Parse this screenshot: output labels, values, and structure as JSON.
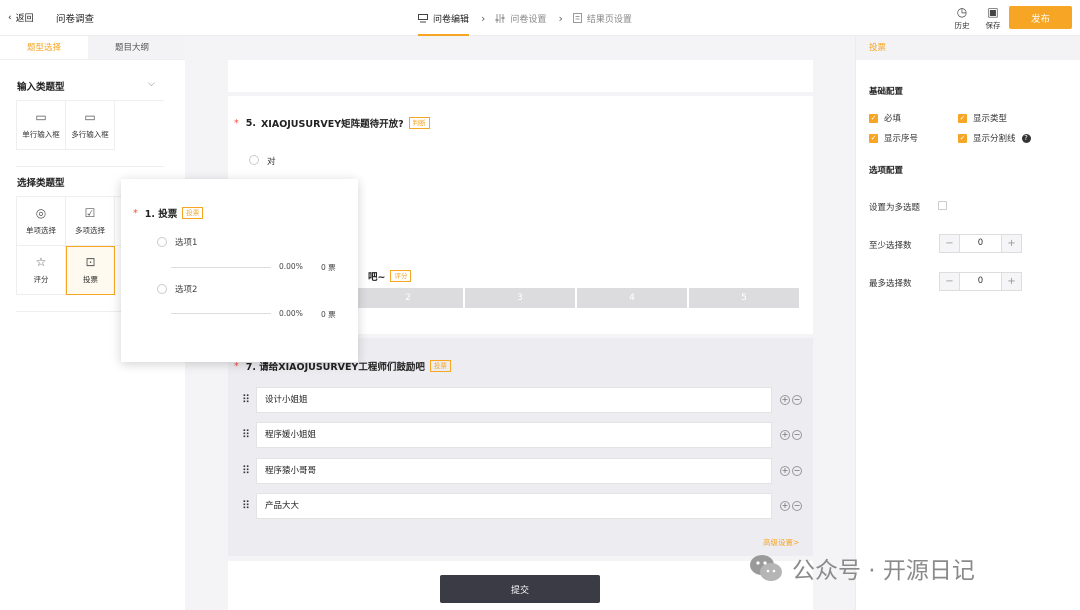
{
  "header": {
    "back_label": "返回",
    "title": "问卷调查",
    "steps": [
      {
        "label": "问卷编辑",
        "icon": "form-icon"
      },
      {
        "label": "问卷设置",
        "icon": "tune-icon"
      },
      {
        "label": "结果页设置",
        "icon": "doc-icon"
      }
    ],
    "history_label": "历史",
    "save_label": "保存",
    "publish_label": "发布",
    "accent": "#f7a524"
  },
  "left": {
    "tabs": [
      "题型选择",
      "题目大纲"
    ],
    "input_section": "输入类题型",
    "input_types": [
      "单行输入框",
      "多行输入框"
    ],
    "select_section": "选择类题型",
    "select_types": [
      "单项选择",
      "多项选择",
      "评分",
      "投票"
    ]
  },
  "canvas": {
    "q5": {
      "number": "5.",
      "title": "XIAOJUSURVEY矩阵题待开放?",
      "tag": "判断",
      "option": "对"
    },
    "q6": {
      "title_tail": "吧~",
      "tag": "评分",
      "scores": [
        "2",
        "3",
        "4",
        "5"
      ]
    },
    "q7": {
      "title": "7. 请给XIAOJUSURVEY工程师们鼓励吧",
      "tag": "投票",
      "options": [
        "设计小姐姐",
        "程序媛小姐姐",
        "程序猿小哥哥",
        "产品大大"
      ],
      "advanced": "高级设置>"
    },
    "submit_label": "提交"
  },
  "popup": {
    "title": "1.  投票",
    "tag": "投票",
    "options": [
      {
        "label": "选项1",
        "pct": "0.00%",
        "count": "0 票"
      },
      {
        "label": "选项2",
        "pct": "0.00%",
        "count": "0 票"
      }
    ]
  },
  "right": {
    "header": "投票",
    "basic_title": "基础配置",
    "checks": [
      {
        "label": "必填",
        "checked": true
      },
      {
        "label": "显示类型",
        "checked": true
      },
      {
        "label": "显示序号",
        "checked": true
      },
      {
        "label": "显示分割线",
        "checked": true
      }
    ],
    "option_title": "选项配置",
    "multi_label": "设置为多选题",
    "min_label": "至少选择数",
    "min_value": "0",
    "max_label": "最多选择数",
    "max_value": "0"
  },
  "watermark": {
    "text": "公众号 · 开源日记"
  }
}
